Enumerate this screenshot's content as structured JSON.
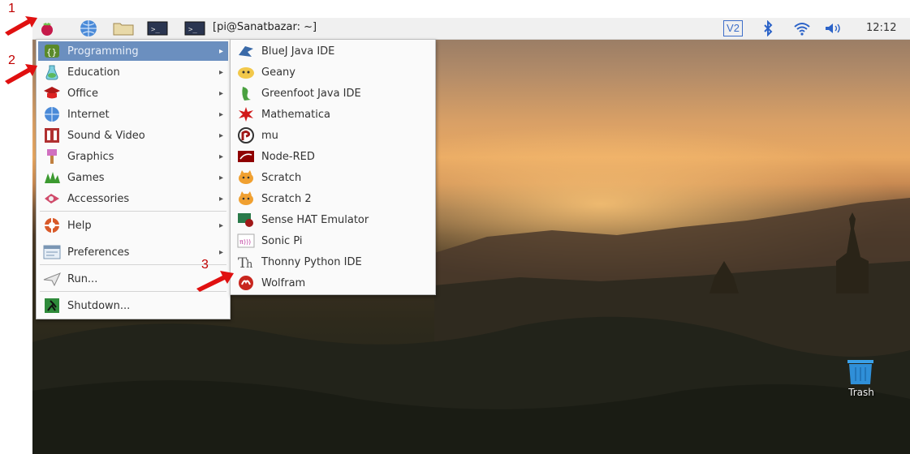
{
  "taskbar": {
    "terminal_label": "[pi@Sanatbazar: ~]",
    "tray_v2": "V2",
    "clock": "12:12"
  },
  "annotations": {
    "a1": "1",
    "a2": "2",
    "a3": "3"
  },
  "main_menu": {
    "items": [
      {
        "label": "Programming",
        "icon": "programming-icon"
      },
      {
        "label": "Education",
        "icon": "education-icon"
      },
      {
        "label": "Office",
        "icon": "office-icon"
      },
      {
        "label": "Internet",
        "icon": "internet-icon"
      },
      {
        "label": "Sound & Video",
        "icon": "sound-video-icon"
      },
      {
        "label": "Graphics",
        "icon": "graphics-icon"
      },
      {
        "label": "Games",
        "icon": "games-icon"
      },
      {
        "label": "Accessories",
        "icon": "accessories-icon"
      },
      {
        "label": "Help",
        "icon": "help-icon"
      },
      {
        "label": "Preferences",
        "icon": "preferences-icon"
      },
      {
        "label": "Run...",
        "icon": "run-icon"
      },
      {
        "label": "Shutdown...",
        "icon": "shutdown-icon"
      }
    ],
    "selected": "Programming"
  },
  "programming_submenu": {
    "items": [
      {
        "label": "BlueJ Java IDE",
        "icon": "bluej-icon"
      },
      {
        "label": "Geany",
        "icon": "geany-icon"
      },
      {
        "label": "Greenfoot Java IDE",
        "icon": "greenfoot-icon"
      },
      {
        "label": "Mathematica",
        "icon": "mathematica-icon"
      },
      {
        "label": "mu",
        "icon": "mu-icon"
      },
      {
        "label": "Node-RED",
        "icon": "node-red-icon"
      },
      {
        "label": "Scratch",
        "icon": "scratch-icon"
      },
      {
        "label": "Scratch 2",
        "icon": "scratch2-icon"
      },
      {
        "label": "Sense HAT Emulator",
        "icon": "sense-hat-icon"
      },
      {
        "label": "Sonic Pi",
        "icon": "sonic-pi-icon"
      },
      {
        "label": "Thonny Python IDE",
        "icon": "thonny-icon"
      },
      {
        "label": "Wolfram",
        "icon": "wolfram-icon"
      }
    ]
  },
  "desktop": {
    "trash_label": "Trash"
  },
  "colors": {
    "menu_highlight": "#6b8fbf",
    "annotation_red": "#e01010",
    "taskbar": "#f0f0f0"
  }
}
